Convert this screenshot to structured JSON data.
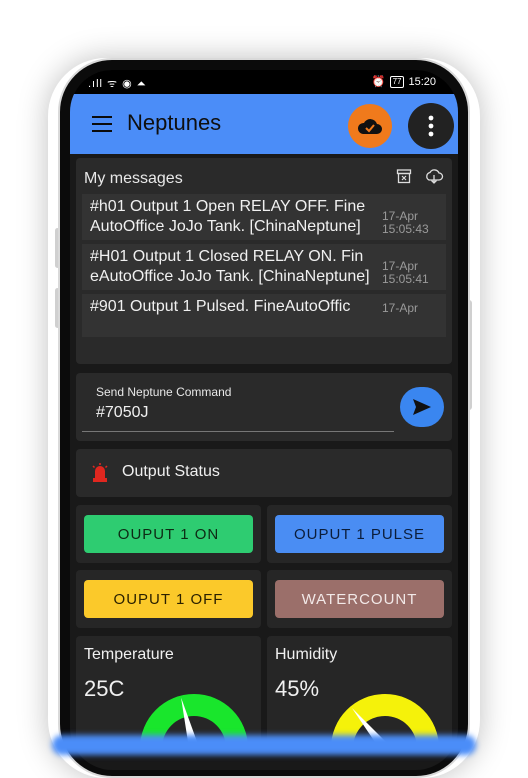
{
  "statusbar": {
    "left_icons": ".ıll ᯤ ◉ ⏶",
    "alarm": "⏰",
    "battery": "77",
    "time": "15:20"
  },
  "appbar": {
    "title": "Neptunes",
    "accent": "#4b8df8",
    "cloud_button_color": "#f07a1c"
  },
  "messages": {
    "title": "My messages",
    "items": [
      {
        "text": "#h01 Output 1 Open RELAY OFF. FineAutoOffice JoJo Tank. [ChinaNeptune]",
        "date": "17-Apr",
        "time": "15:05:43"
      },
      {
        "text": "#H01 Output 1 Closed RELAY ON. FineAutoOffice JoJo Tank. [ChinaNeptune]",
        "date": "17-Apr",
        "time": "15:05:41"
      },
      {
        "text": "#901 Output 1 Pulsed. FineAutoOffic",
        "date": "17-Apr",
        "time": ""
      }
    ]
  },
  "command": {
    "label": "Send Neptune Command",
    "value": "#7050J"
  },
  "output_status": {
    "label": "Output Status"
  },
  "buttons": [
    {
      "label": "OUPUT 1 ON",
      "color": "#2ecc71",
      "text_color": "#0d2a14"
    },
    {
      "label": "OUPUT 1 PULSE",
      "color": "#4a8df3",
      "text_color": "#0b1d3a"
    },
    {
      "label": "OUPUT 1 OFF",
      "color": "#fbc92a",
      "text_color": "#2b2100"
    },
    {
      "label": "WATERCOUNT",
      "color": "#9b6f6a",
      "text_color": "#f2e9e8"
    }
  ],
  "gauges": [
    {
      "title": "Temperature",
      "value_text": "25C",
      "color": "#19e62c",
      "level": 0.42
    },
    {
      "title": "Humidity",
      "value_text": "45%",
      "color": "#f5f20a",
      "level": 0.28
    }
  ]
}
